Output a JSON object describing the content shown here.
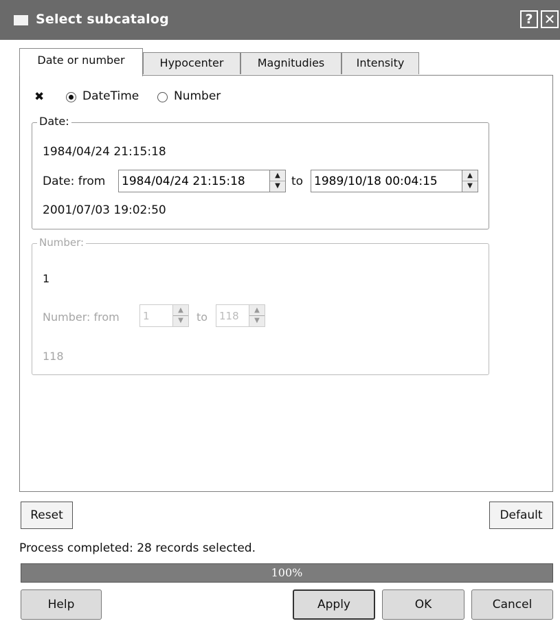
{
  "window": {
    "title": "Select subcatalog",
    "help_symbol": "?",
    "close_symbol": "✕",
    "icon": "window-icon"
  },
  "tabs": [
    {
      "label": "Date or number",
      "active": true
    },
    {
      "label": "Hypocenter",
      "active": false
    },
    {
      "label": "Magnitudies",
      "active": false
    },
    {
      "label": "Intensity",
      "active": false
    }
  ],
  "filter": {
    "enabled_checkbox": "✖",
    "mode_datetime": "DateTime",
    "mode_number": "Number",
    "selected_mode": "DateTime"
  },
  "date_group": {
    "title": "Date:",
    "min_value": "1984/04/24 21:15:18",
    "from_label": "Date: from",
    "from_value": "1984/04/24 21:15:18",
    "to_label": "to",
    "to_value": "1989/10/18 00:04:15",
    "max_value": "2001/07/03 19:02:50"
  },
  "number_group": {
    "title": "Number:",
    "min_value": "1",
    "from_label": "Number: from",
    "from_value": "1",
    "to_label": "to",
    "to_value": "118",
    "max_value": "118"
  },
  "buttons": {
    "reset": "Reset",
    "default": "Default",
    "help": "Help",
    "apply": "Apply",
    "ok": "OK",
    "cancel": "Cancel"
  },
  "status": {
    "message": "Process completed: 28 records selected.",
    "progress_text": "100%",
    "progress_fraction": 1.0
  },
  "colors": {
    "titlebar": "#6a6a6a",
    "progress_fill": "#7c7c7c"
  }
}
